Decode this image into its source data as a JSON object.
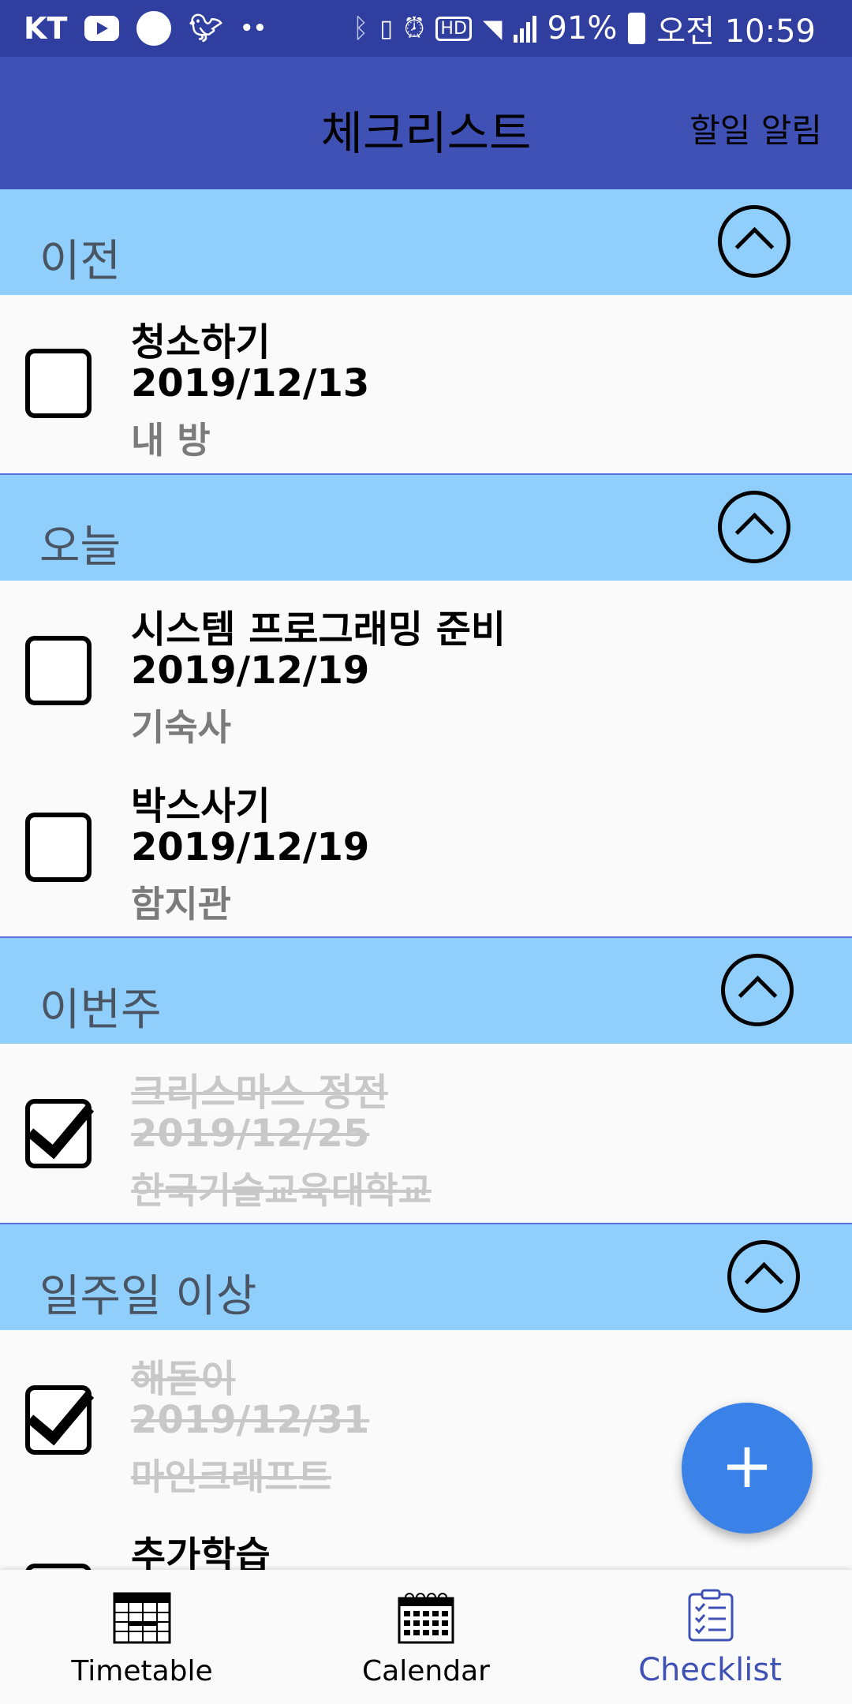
{
  "status_bar": {
    "carrier": "KT",
    "battery": "91%",
    "time": "오전 10:59"
  },
  "app_bar": {
    "title": "체크리스트",
    "action_label": "할일 알림"
  },
  "sections": [
    {
      "label": "이전",
      "items": [
        {
          "title": "청소하기",
          "date": "2019/12/13",
          "place": "내 방",
          "checked": false
        }
      ]
    },
    {
      "label": "오늘",
      "items": [
        {
          "title": "시스템 프로그래밍 준비",
          "date": "2019/12/19",
          "place": "기숙사",
          "checked": false
        },
        {
          "title": "박스사기",
          "date": "2019/12/19",
          "place": "함지관",
          "checked": false
        }
      ]
    },
    {
      "label": "이번주",
      "items": [
        {
          "title": "크리스마스 정전",
          "date": "2019/12/25",
          "place": "한국기술교육대학교",
          "checked": true
        }
      ]
    },
    {
      "label": "일주일 이상",
      "items": [
        {
          "title": "해돋이",
          "date": "2019/12/31",
          "place": "마인크래프트",
          "checked": true
        },
        {
          "title": "추가학습",
          "checked": false
        }
      ]
    }
  ],
  "fab": {
    "label": "+"
  },
  "bottom_nav": {
    "items": [
      {
        "label": "Timetable",
        "icon": "timetable-icon"
      },
      {
        "label": "Calendar",
        "icon": "calendar-icon"
      },
      {
        "label": "Checklist",
        "icon": "checklist-icon",
        "active": true
      }
    ]
  },
  "colors": {
    "status_bar": "#303f9f",
    "app_bar": "#3f51b5",
    "section_header": "#90cefc",
    "fab": "#3b82e8",
    "active_nav": "#3f51b5"
  }
}
